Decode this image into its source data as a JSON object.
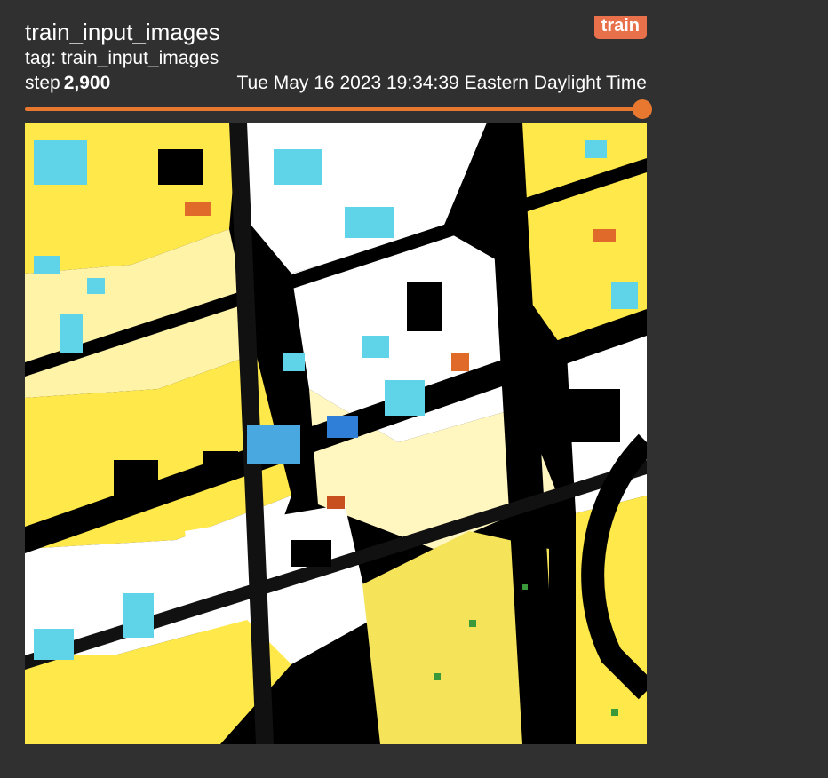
{
  "card": {
    "title": "train_input_images",
    "run_badge": "train",
    "tag_line": "tag: train_input_images",
    "step_label": "step",
    "step_value": "2,900",
    "timestamp": "Tue May 16 2023 19:34:39 Eastern Daylight Time"
  },
  "slider": {
    "value_fraction": 1.0
  },
  "colors": {
    "background": "#303030",
    "accent": "#e8782f",
    "badge": "#e8704a",
    "image_yellow": "#ffe84a",
    "image_cyan": "#5fd3e8"
  },
  "image": {
    "description_kind": "satellite-style aerial image (false color)"
  }
}
